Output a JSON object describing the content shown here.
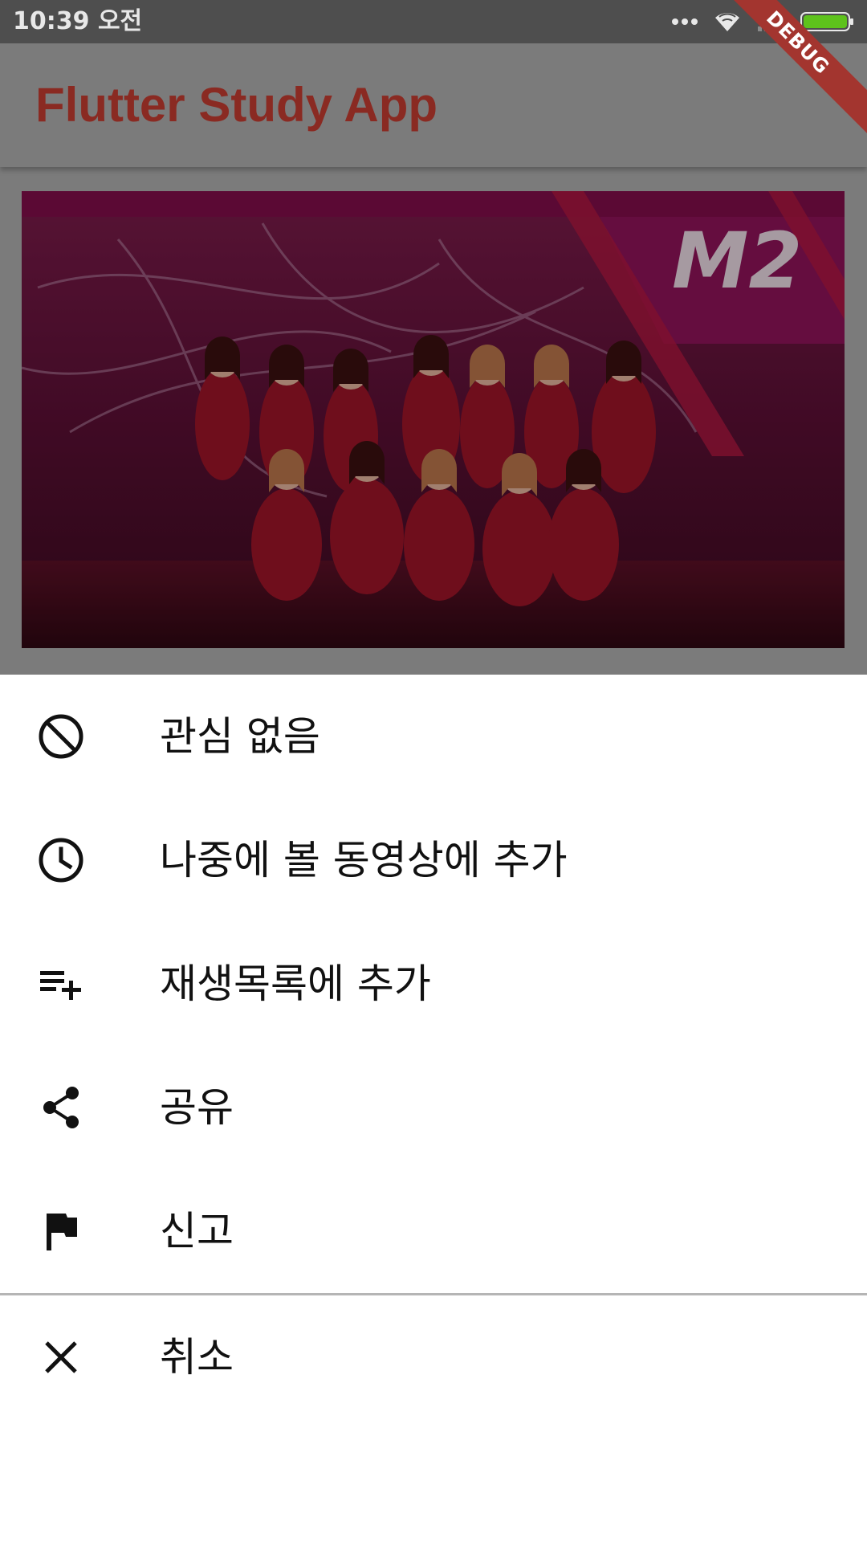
{
  "status_bar": {
    "time": "10:39 오전",
    "icons": [
      "more-dots-icon",
      "wifi-icon",
      "signal-icon",
      "battery-icon"
    ]
  },
  "debug_banner": "DEBUG",
  "app_bar": {
    "title": "Flutter Study App"
  },
  "thumbnail": {
    "channel_logo_text": "M2"
  },
  "bottom_sheet": {
    "items": [
      {
        "icon": "block-icon",
        "label": "관심 없음"
      },
      {
        "icon": "clock-icon",
        "label": "나중에 볼 동영상에 추가"
      },
      {
        "icon": "playlist-add-icon",
        "label": "재생목록에 추가"
      },
      {
        "icon": "share-icon",
        "label": "공유"
      },
      {
        "icon": "flag-icon",
        "label": "신고"
      }
    ],
    "cancel": {
      "icon": "close-icon",
      "label": "취소"
    }
  },
  "colors": {
    "status_bar": "#4e4e4e",
    "app_bar_dimmed": "#7b7b7b",
    "title_text": "#8a2a22",
    "debug_ribbon": "#a3352f",
    "sheet_background": "#ffffff",
    "divider": "#b5b5b5"
  }
}
